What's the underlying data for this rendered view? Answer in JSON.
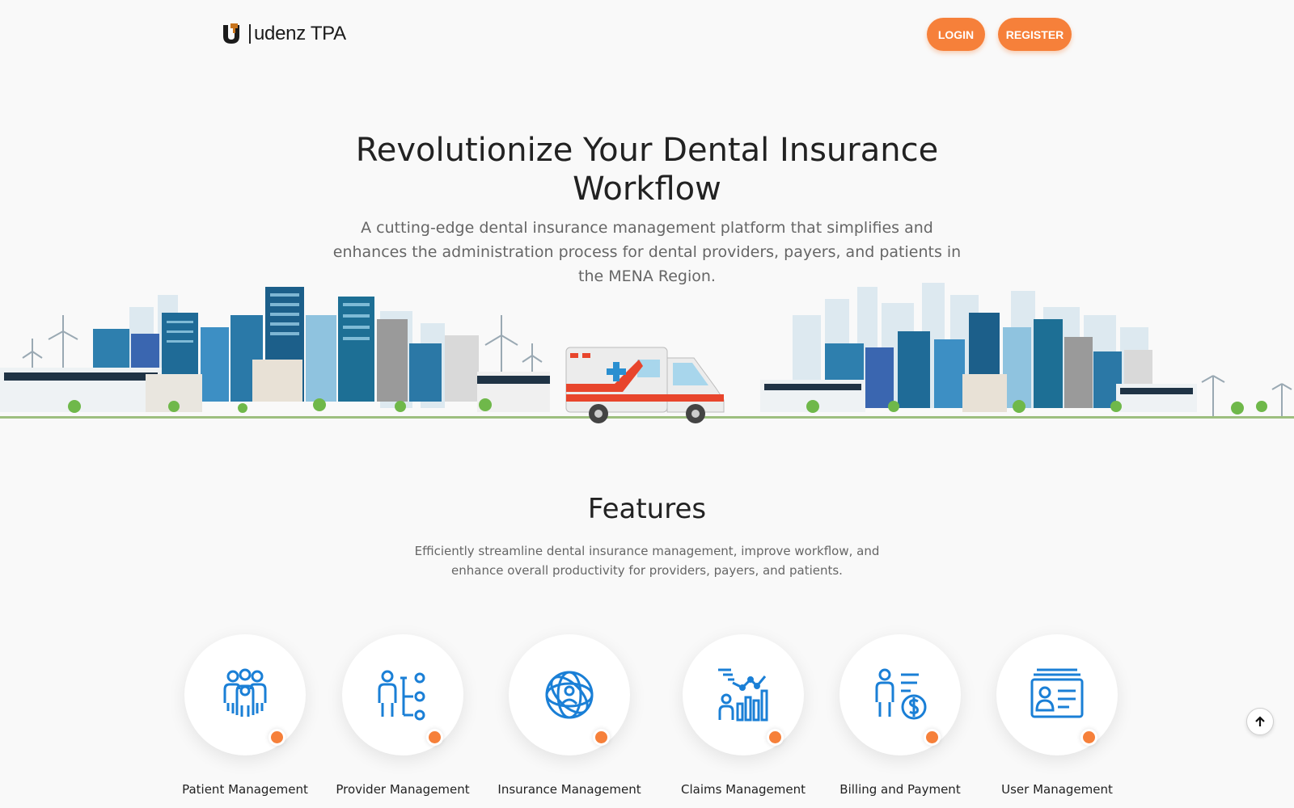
{
  "brand": {
    "name": "udenz TPA",
    "accent": "#f6803a",
    "icon_blue": "#1a7fd6"
  },
  "header": {
    "login_label": "LOGIN",
    "register_label": "REGISTER"
  },
  "hero": {
    "title": "Revolutionize Your Dental Insurance Workflow",
    "subtitle": "A cutting-edge dental insurance management platform that simplifies and enhances the administration process for dental providers, payers, and patients in the MENA Region."
  },
  "illustration": {
    "description_icon": "city-skyline-ambulance-illustration"
  },
  "features": {
    "title": "Features",
    "subtitle": "Efficiently streamline dental insurance management, improve workflow, and enhance overall productivity for providers, payers, and patients.",
    "items": [
      {
        "label": "Patient Management",
        "icon": "patients-icon"
      },
      {
        "label": "Provider Management",
        "icon": "provider-network-icon"
      },
      {
        "label": "Insurance Management",
        "icon": "insurance-globe-icon"
      },
      {
        "label": "Claims Management",
        "icon": "claims-chart-icon"
      },
      {
        "label": "Billing and Payment",
        "icon": "billing-dollar-icon"
      },
      {
        "label": "User Management",
        "icon": "user-id-card-icon"
      }
    ]
  },
  "scroll_top": {
    "icon": "arrow-up-icon"
  }
}
